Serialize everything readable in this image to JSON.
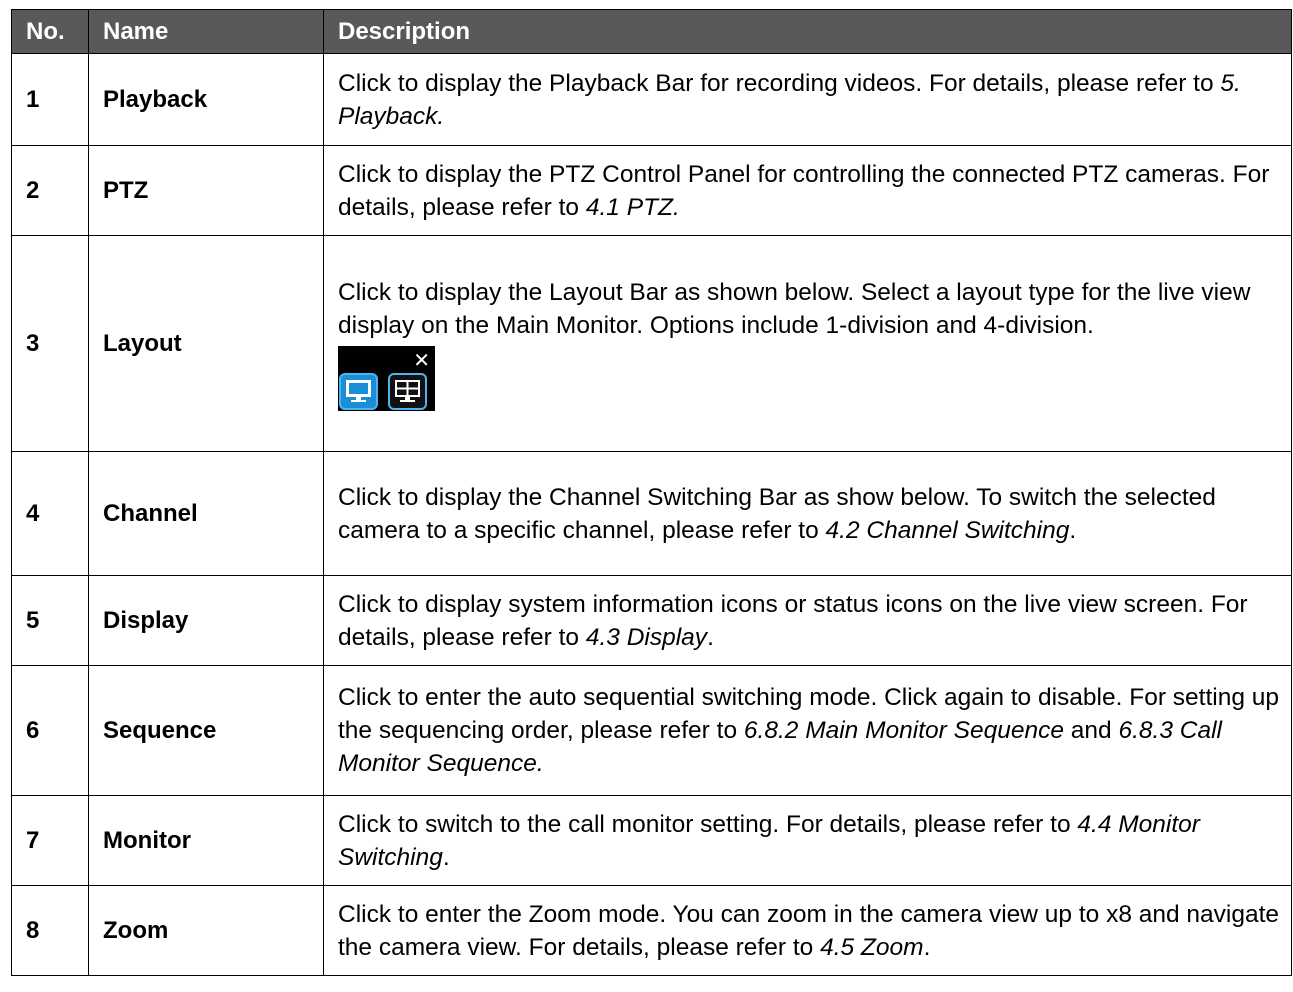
{
  "headers": {
    "no": "No.",
    "name": "Name",
    "description": "Description"
  },
  "rows": [
    {
      "no": "1",
      "name": "Playback",
      "desc": "Click to display the Playback Bar for recording videos. For details, please refer to ",
      "ref": "5. Playback.",
      "tail": ""
    },
    {
      "no": "2",
      "name": "PTZ",
      "desc": "Click to display the PTZ Control Panel for controlling the connected PTZ cameras.  For details, please refer to ",
      "ref": "4.1 PTZ.",
      "tail": ""
    },
    {
      "no": "3",
      "name": "Layout",
      "desc": "Click to display the Layout Bar as shown below. Select a layout type for the live view display on the Main Monitor. Options include 1-division and 4-division."
    },
    {
      "no": "4",
      "name": "Channel",
      "desc": "Click to display the Channel Switching Bar as show below. To switch the selected camera to a specific channel, please refer to ",
      "ref": "4.2 Channel Switching",
      "tail": "."
    },
    {
      "no": "5",
      "name": "Display",
      "desc": "Click to display system information icons or status icons on the live view screen. For details, please refer to ",
      "ref": "4.3 Display",
      "tail": "."
    },
    {
      "no": "6",
      "name": "Sequence",
      "desc": "Click to enter the auto sequential switching mode. Click again to disable. For setting up the sequencing order, please refer to ",
      "ref": "6.8.2 Main Monitor Sequence",
      "mid": " and ",
      "ref2": "6.8.3 Call Monitor Sequence."
    },
    {
      "no": "7",
      "name": "Monitor",
      "desc": "Click to switch to the call monitor setting.  For details, please refer to ",
      "ref": "4.4 Monitor Switching",
      "tail": "."
    },
    {
      "no": "8",
      "name": "Zoom",
      "desc": "Click to enter the Zoom mode. You can zoom in the camera view up to x8 and navigate the camera view.  For details, please refer to ",
      "ref": "4.5 Zoom",
      "tail": "."
    }
  ],
  "layout_bar": {
    "close_glyph": "✕",
    "accent": "#1a8fd8",
    "icons": [
      "single-division-icon",
      "quad-division-icon"
    ]
  }
}
